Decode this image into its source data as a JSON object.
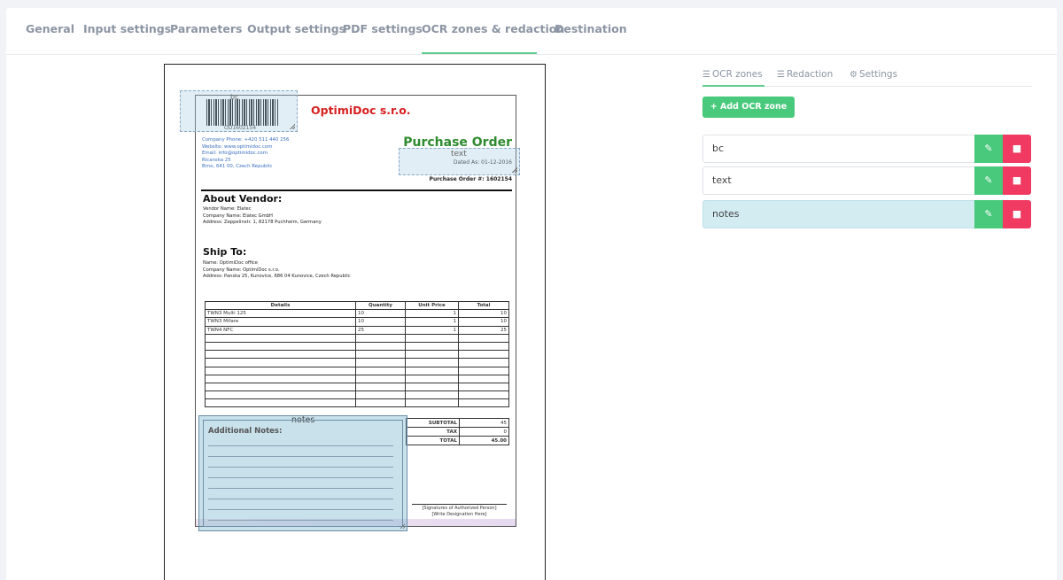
{
  "tabs": [
    "General",
    "Input settings",
    "Parameters",
    "Output settings",
    "PDF settings",
    "OCR zones & redaction",
    "Destination"
  ],
  "active_tab": "OCR zones & redaction",
  "document": {
    "barcode_text": "OD1602154",
    "company": "OptimiDoc s.r.o.",
    "contact": [
      "Company Phone: +420 511 440 256",
      "Website: www.optimidoc.com",
      "Email: info@optimidoc.com",
      "Ricanska 25",
      "Brno, 641 00, Czech Republic"
    ],
    "title": "Purchase Order",
    "dated": "Dated As: 01-12-2016",
    "po_number": "Purchase Order #: 1602154",
    "vendor_heading": "About Vendor:",
    "vendor": [
      "Vendor Name: Elatec",
      "Company Name: Elatec GmbH",
      "Address: Zeppelinstr. 1, 82178 Puchheim, Germany"
    ],
    "ship_heading": "Ship To:",
    "ship": [
      "Name: OptimiDoc office",
      "Company Name: OptimiDoc s.r.o.",
      "Address: Panska 25, Kunovice, 686 04 Kunovice, Czech Republic"
    ],
    "table_headers": [
      "Details",
      "Quantity",
      "Unit Price",
      "Total"
    ],
    "table_rows": [
      [
        "TWN3 Multi 125",
        "10",
        "1",
        "10"
      ],
      [
        "TWN3 Mifare",
        "10",
        "1",
        "10"
      ],
      [
        "TWN4 NFC",
        "25",
        "1",
        "25"
      ]
    ],
    "summary": [
      [
        "SUBTOTAL",
        "45"
      ],
      [
        "TAX",
        "0"
      ],
      [
        "TOTAL",
        "45.00"
      ]
    ],
    "signature": [
      "[Signatures of Authorized Person]",
      "[Write Designation Here]"
    ],
    "notes_title": "Additional Notes:"
  },
  "zones": {
    "bc_label": "bc",
    "text_label": "text",
    "notes_label": "notes"
  },
  "panel": {
    "subtabs": [
      "OCR zones",
      "Redaction",
      "Settings"
    ],
    "add_label": "+ Add OCR zone",
    "list": [
      "bc",
      "text",
      "notes"
    ],
    "selected": "notes"
  },
  "colors": {
    "accent": "#48c97b",
    "danger": "#f03a62",
    "selected_row": "#d2ecf2"
  }
}
